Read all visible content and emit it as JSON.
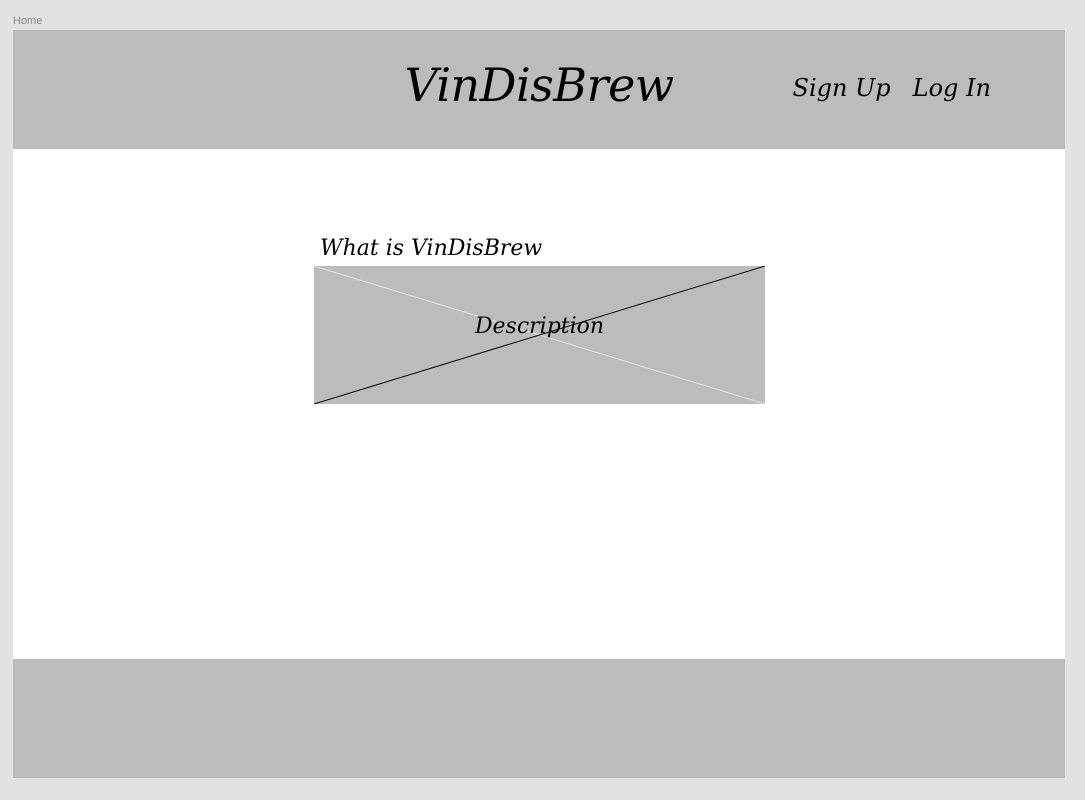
{
  "frame": {
    "label": "Home"
  },
  "header": {
    "brand": "VinDisBrew",
    "nav": {
      "sign_up": "Sign Up",
      "log_in": "Log In"
    }
  },
  "main": {
    "section_title": "What is VinDisBrew",
    "description_placeholder": "Description"
  },
  "colors": {
    "canvas": "#e2e2e2",
    "page": "#ffffff",
    "bars": "#bcbcbc",
    "text": "#000000"
  }
}
